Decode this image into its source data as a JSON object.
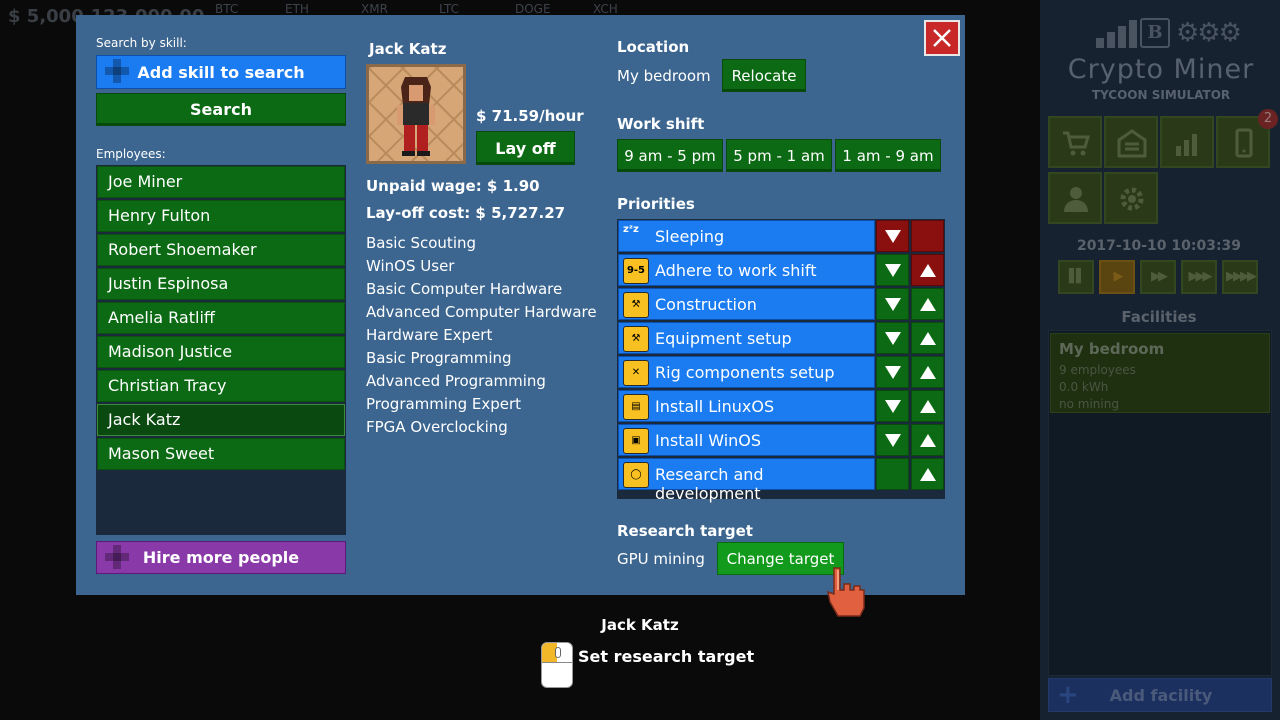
{
  "ticker": {
    "money": "$ 5,000,123,000.00",
    "coins": [
      "BTC",
      "ETH",
      "XMR",
      "LTC",
      "DOGE",
      "XCH"
    ]
  },
  "sidebar": {
    "logo_title": "Crypto Miner",
    "logo_subtitle": "TYCOON SIMULATOR",
    "notification_count": "2",
    "datetime": "2017-10-10 10:03:39",
    "facilities_title": "Facilities",
    "facility": {
      "name": "My bedroom",
      "employees": "9 employees",
      "power": "0.0 kWh",
      "status": "no mining"
    },
    "add_facility_label": "Add facility",
    "buttons": [
      "shop-icon",
      "warehouse-icon",
      "stats-icon",
      "phone-icon",
      "person-icon",
      "gear-icon"
    ],
    "speed_buttons": [
      "pause-icon",
      "play-icon",
      "fast-forward-icon",
      "faster-icon",
      "fastest-icon"
    ]
  },
  "modal": {
    "search_by_skill_label": "Search by skill:",
    "add_skill_label": "Add skill to search",
    "search_label": "Search",
    "employees_label": "Employees:",
    "employees": [
      "Joe Miner",
      "Henry Fulton",
      "Robert Shoemaker",
      "Justin Espinosa",
      "Amelia Ratliff",
      "Madison Justice",
      "Christian Tracy",
      "Jack Katz",
      "Mason Sweet"
    ],
    "selected_employee_index": 7,
    "hire_label": "Hire more people",
    "employee": {
      "name": "Jack Katz",
      "wage": "$ 71.59/hour",
      "layoff_label": "Lay off",
      "unpaid_wage": "Unpaid wage: $ 1.90",
      "layoff_cost": "Lay-off cost: $ 5,727.27",
      "skills": [
        "Basic Scouting",
        "WinOS User",
        "Basic Computer Hardware",
        "Advanced Computer Hardware",
        "Hardware Expert",
        "Basic Programming",
        "Advanced Programming",
        "Programming Expert",
        "FPGA Overclocking"
      ]
    },
    "location_title": "Location",
    "location_value": "My bedroom",
    "relocate_label": "Relocate",
    "work_shift_title": "Work shift",
    "shifts": [
      "9 am - 5 pm",
      "5 pm - 1 am",
      "1 am - 9 am"
    ],
    "priorities_title": "Priorities",
    "priorities": [
      {
        "label": "Sleeping",
        "icon": "sleep-icon",
        "glyph": "zᶻz"
      },
      {
        "label": "Adhere to work shift",
        "icon": "schedule-icon",
        "glyph": "9-5"
      },
      {
        "label": "Construction",
        "icon": "construction-icon",
        "glyph": "⚒"
      },
      {
        "label": "Equipment setup",
        "icon": "wrench-icon",
        "glyph": "⚒"
      },
      {
        "label": "Rig components setup",
        "icon": "tools-icon",
        "glyph": "✕"
      },
      {
        "label": "Install LinuxOS",
        "icon": "linux-install-icon",
        "glyph": "▤"
      },
      {
        "label": "Install WinOS",
        "icon": "win-install-icon",
        "glyph": "▣"
      },
      {
        "label": "Research and development",
        "icon": "lightbulb-icon",
        "glyph": "◯"
      }
    ],
    "research_title": "Research target",
    "research_value": "GPU mining",
    "change_target_label": "Change target"
  },
  "hint": {
    "name": "Jack Katz",
    "action": "Set research target",
    "icon": "mouse-left-click-icon"
  },
  "colors": {
    "modal_bg": "#3c6690",
    "green_button": "#0c6a14",
    "blue_button": "#1a7cf0",
    "purple_button": "#8a3aa8",
    "close_red": "#c82828",
    "arrow_red": "#8a1010"
  }
}
